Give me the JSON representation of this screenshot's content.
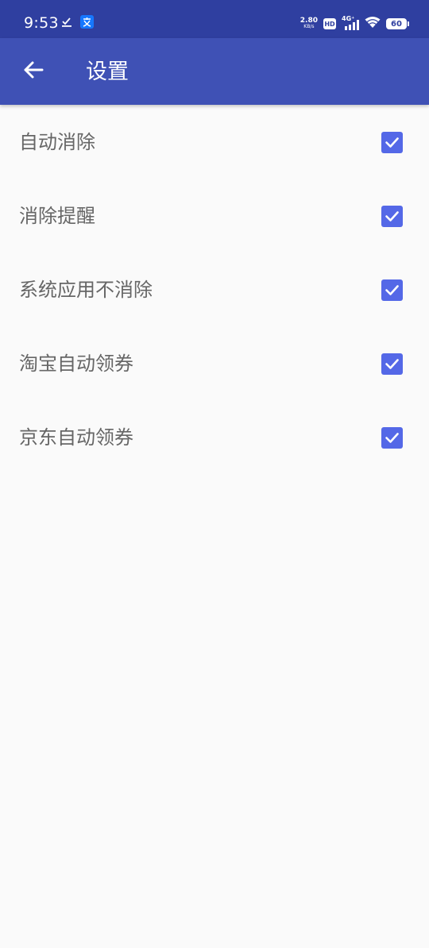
{
  "status_bar": {
    "time": "9:53",
    "net_speed_value": "2.80",
    "net_speed_unit": "KB/s",
    "hd_label": "HD",
    "network_type": "4G⁺",
    "battery_level": "60",
    "left_icons": [
      "download-done-icon",
      "alipay-icon"
    ],
    "right_icons": [
      "signal-icon",
      "wifi-icon",
      "battery-icon"
    ]
  },
  "app_bar": {
    "back_icon": "arrow-left-icon",
    "title": "设置"
  },
  "settings": [
    {
      "label": "自动消除",
      "checked": true
    },
    {
      "label": "消除提醒",
      "checked": true
    },
    {
      "label": "系统应用不消除",
      "checked": true
    },
    {
      "label": "淘宝自动领券",
      "checked": true
    },
    {
      "label": "京东自动领券",
      "checked": true
    }
  ],
  "colors": {
    "status_bar": "#2f3fa0",
    "app_bar": "#3f51b5",
    "checkbox": "#5468e7",
    "label_text": "#666666",
    "background": "#fafafa"
  }
}
